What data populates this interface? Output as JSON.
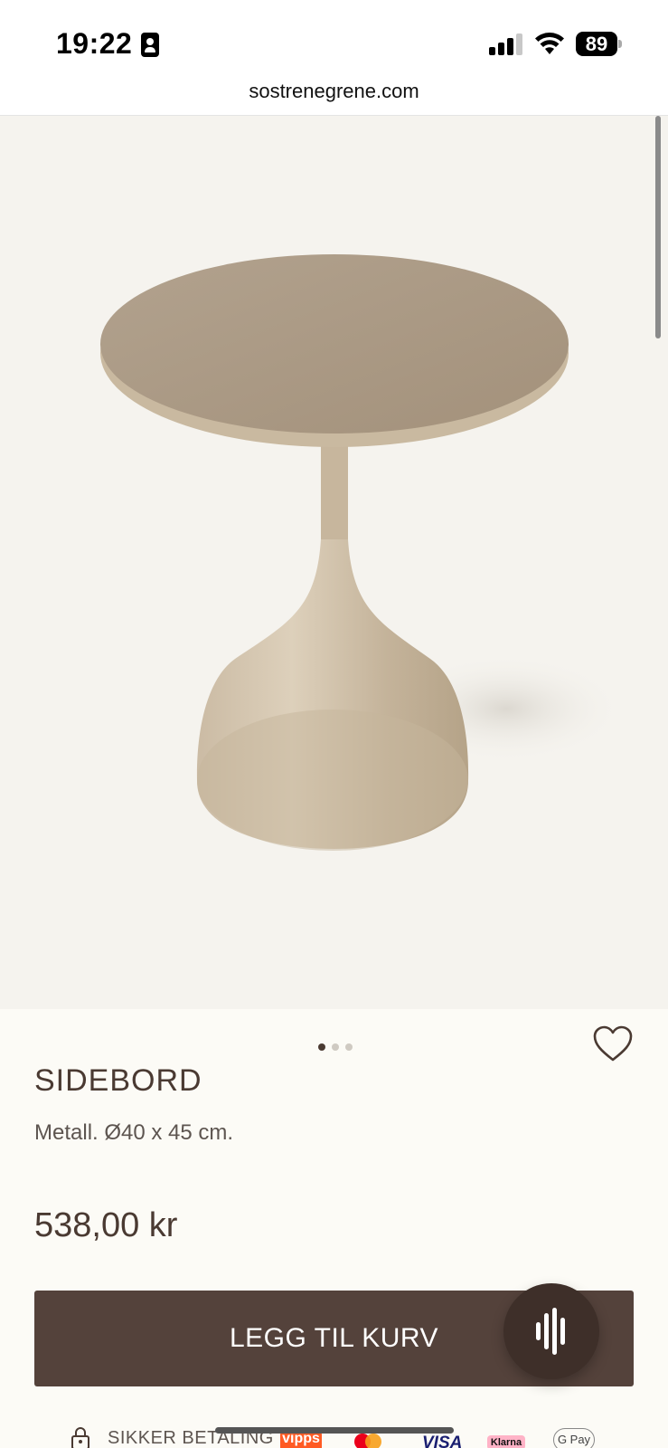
{
  "status_bar": {
    "time": "19:22",
    "battery": "89",
    "icons": [
      "contact-card-icon",
      "cellular-signal-icon",
      "wifi-icon",
      "battery-icon"
    ]
  },
  "browser": {
    "url": "sostrenegrene.com"
  },
  "product": {
    "image": "side-table-image",
    "image_count": 3,
    "active_image": 1,
    "title": "SIDEBORD",
    "description": "Metall. Ø40 x 45 cm.",
    "price": "538,00 kr"
  },
  "actions": {
    "add_to_cart_label": "LEGG TIL KURV",
    "favorite_icon": "heart-icon",
    "voice_icon": "audio-waveform-icon"
  },
  "payment": {
    "secure_label": "SIKKER BETALING",
    "methods": {
      "vipps": "vipps",
      "visa": "VISA",
      "klarna": "Klarna",
      "gpay": "G Pay"
    }
  },
  "colors": {
    "accent": "#54423b",
    "text": "#4a3a32",
    "page_background": "#fcfbf6",
    "image_background": "#f5f3ee"
  }
}
